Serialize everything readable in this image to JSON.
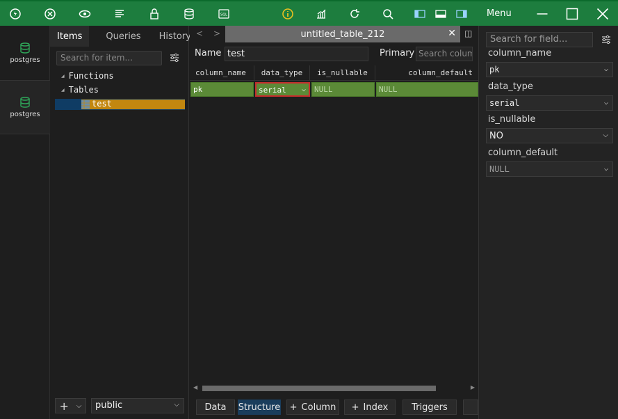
{
  "toolbar": {
    "menu_label": "Menu",
    "colors": {
      "bg": "#1d7d3e",
      "info": "#e8c020"
    },
    "icons": [
      "connect-icon",
      "disconnect-icon",
      "view-icon",
      "format-icon",
      "lock-icon",
      "database-icon",
      "sql-icon",
      "info-icon",
      "chart-icon",
      "refresh-icon",
      "search-icon",
      "layout-left-icon",
      "layout-bottom-icon",
      "layout-right-icon"
    ]
  },
  "rail": {
    "connections": [
      {
        "label": "postgres"
      },
      {
        "label": "postgres"
      }
    ]
  },
  "explorer": {
    "tabs": [
      "Items",
      "Queries",
      "History"
    ],
    "active_tab": "Items",
    "search_placeholder": "Search for item...",
    "tree": {
      "functions": "Functions",
      "tables": "Tables",
      "table_item": "test"
    },
    "schema_value": "public",
    "add_label": "+"
  },
  "main": {
    "tab_title": "untitled_table_212",
    "name_label": "Name",
    "name_value": "test",
    "primary_label": "Primary",
    "primary_placeholder": "Search colum",
    "columns": [
      "column_name",
      "data_type",
      "is_nullable",
      "column_default"
    ],
    "row": {
      "column_name": "pk",
      "data_type": "serial",
      "is_nullable": "NULL",
      "column_default": "NULL"
    },
    "bottom_tabs": [
      "Data",
      "Structure",
      "Column",
      "Index",
      "Triggers"
    ],
    "active_bottom_tab": "Structure"
  },
  "right_panel": {
    "search_placeholder": "Search for field...",
    "fields": [
      {
        "label": "column_name",
        "value": "pk"
      },
      {
        "label": "data_type",
        "value": "serial"
      },
      {
        "label": "is_nullable",
        "value": "NO"
      },
      {
        "label": "column_default",
        "value": "NULL"
      }
    ]
  }
}
